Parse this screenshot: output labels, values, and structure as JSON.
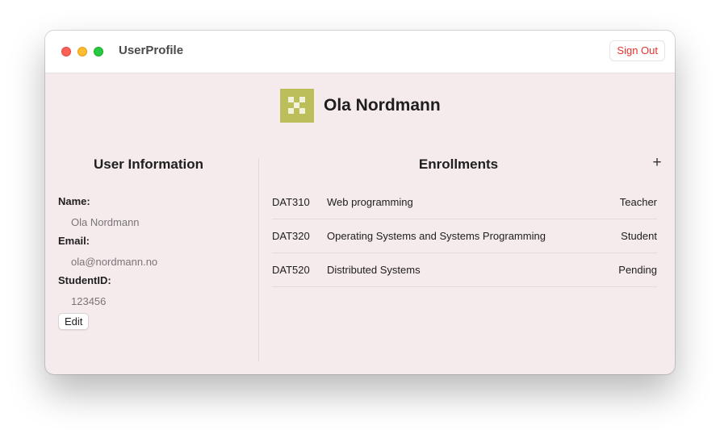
{
  "window": {
    "title": "UserProfile",
    "sign_out_label": "Sign Out"
  },
  "profile": {
    "name": "Ola Nordmann",
    "avatar_icon": "identicon-avatar",
    "avatar_color": "#bcbe5a"
  },
  "user_info": {
    "heading": "User Information",
    "fields": [
      {
        "label": "Name:",
        "value": "Ola Nordmann"
      },
      {
        "label": "Email:",
        "value": "ola@nordmann.no"
      },
      {
        "label": "StudentID:",
        "value": "123456"
      }
    ],
    "edit_label": "Edit"
  },
  "enrollments": {
    "heading": "Enrollments",
    "add_icon": "plus-icon",
    "add_glyph": "+",
    "rows": [
      {
        "code": "DAT310",
        "course": "Web programming",
        "role": "Teacher"
      },
      {
        "code": "DAT320",
        "course": "Operating Systems and Systems Programming",
        "role": "Student"
      },
      {
        "code": "DAT520",
        "course": "Distributed Systems",
        "role": "Pending"
      }
    ]
  },
  "colors": {
    "accent_red": "#e5322d",
    "content_background": "#f5eaec"
  }
}
